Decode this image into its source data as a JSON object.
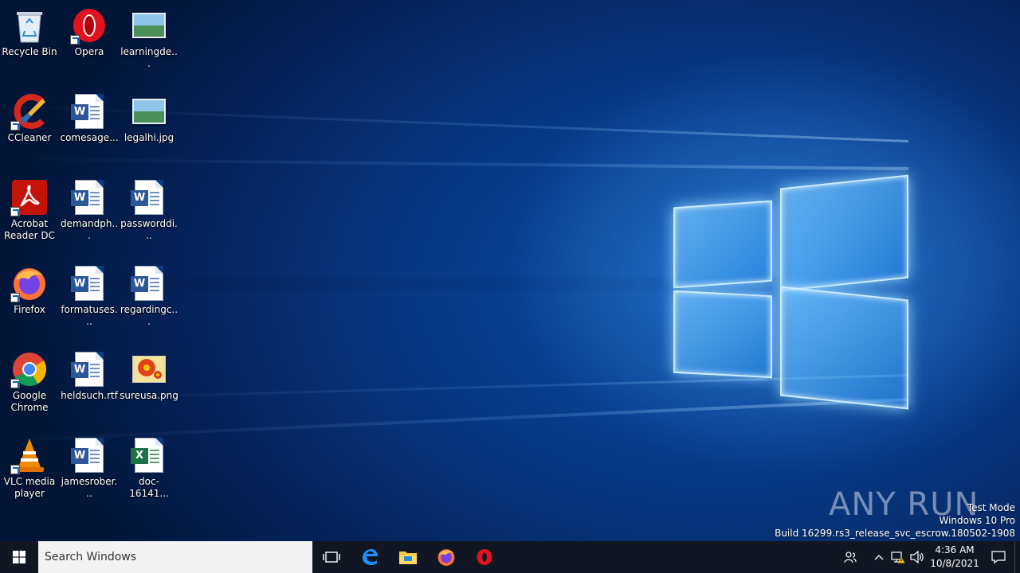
{
  "desktop": {
    "icons": [
      {
        "label": "Recycle Bin"
      },
      {
        "label": "Opera"
      },
      {
        "label": "learningde..."
      },
      {
        "label": "CCleaner"
      },
      {
        "label": "comesage..."
      },
      {
        "label": "legalhi.jpg"
      },
      {
        "label": "Acrobat Reader DC"
      },
      {
        "label": "demandph..."
      },
      {
        "label": "passworddi..."
      },
      {
        "label": "Firefox"
      },
      {
        "label": "formatuses..."
      },
      {
        "label": "regardingc..."
      },
      {
        "label": "Google Chrome"
      },
      {
        "label": "heldsuch.rtf"
      },
      {
        "label": "sureusa.png"
      },
      {
        "label": "VLC media player"
      },
      {
        "label": "jamesrober..."
      },
      {
        "label": "doc-16141..."
      }
    ]
  },
  "watermark": {
    "brand": "ANY RUN",
    "line1": "Test Mode",
    "line2": "Windows 10 Pro",
    "line3": "Build 16299.rs3_release_svc_escrow.180502-1908"
  },
  "taskbar": {
    "search_placeholder": "Search Windows",
    "clock_time": "4:36 AM",
    "clock_date": "10/8/2021"
  },
  "colors": {
    "taskbar": "#101722",
    "accent": "#0078d7"
  }
}
